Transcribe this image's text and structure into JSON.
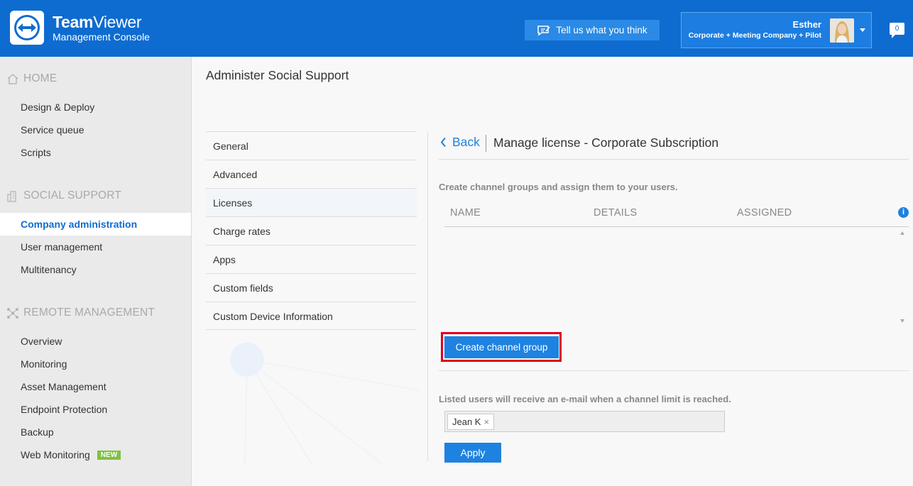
{
  "header": {
    "brand_bold": "Team",
    "brand_light": "Viewer",
    "brand_sub": "Management Console",
    "feedback_label": "Tell us what you think",
    "user_name": "Esther",
    "user_company": "Corporate + Meeting Company + Pilot",
    "notifications_count": "0"
  },
  "sidebar": {
    "sections": [
      {
        "label": "HOME",
        "icon": "home-icon"
      },
      {
        "label": "SOCIAL SUPPORT",
        "icon": "building-icon"
      },
      {
        "label": "REMOTE MANAGEMENT",
        "icon": "network-icon"
      }
    ],
    "home_items": [
      "Design & Deploy",
      "Service queue",
      "Scripts"
    ],
    "social_items": [
      "Company administration",
      "User management",
      "Multitenancy"
    ],
    "remote_items": [
      "Overview",
      "Monitoring",
      "Asset Management",
      "Endpoint Protection",
      "Backup",
      "Web Monitoring"
    ],
    "new_badge": "NEW",
    "active_item": "Company administration"
  },
  "page": {
    "title": "Administer Social Support"
  },
  "settings_nav": {
    "items": [
      "General",
      "Advanced",
      "Licenses",
      "Charge rates",
      "Apps",
      "Custom fields",
      "Custom Device Information"
    ],
    "active": "Licenses"
  },
  "panel": {
    "back_label": "Back",
    "title": "Manage license - Corporate Subscription",
    "description": "Create channel groups and assign them to your users.",
    "columns": [
      "NAME",
      "DETAILS",
      "ASSIGNED"
    ],
    "create_button": "Create channel group",
    "email_note": "Listed users will receive an e-mail when a channel limit is reached.",
    "recipients": [
      "Jean K"
    ],
    "apply_button": "Apply"
  },
  "colors": {
    "header_blue": "#0e6cd0",
    "accent_blue": "#1e82e0",
    "highlight_red": "#e0001a",
    "new_badge_green": "#7fc241"
  }
}
